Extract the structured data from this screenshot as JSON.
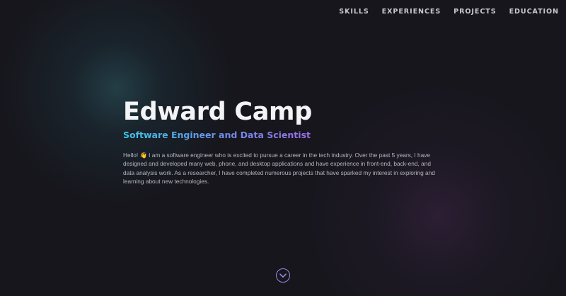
{
  "nav": {
    "items": [
      {
        "label": "SKILLS"
      },
      {
        "label": "EXPERIENCES"
      },
      {
        "label": "PROJECTS"
      },
      {
        "label": "EDUCATION"
      }
    ]
  },
  "hero": {
    "name": "Edward Camp",
    "subtitle": "Software Engineer and Data Scientist",
    "intro": "Hello! 👋 I am a software engineer who is excited to pursue a career in the tech industry. Over the past 5 years, I have designed and developed many web, phone, and desktop applications and have experience in front-end, back-end, and data analysis work. As a researcher, I have completed numerous projects that have sparked my interest in exploring and learning about new technologies."
  },
  "scroll_button": {
    "icon": "chevron-down-icon"
  },
  "colors": {
    "background": "#17161d",
    "accent_start": "#3ec7e8",
    "accent_end": "#9b6ee6",
    "nav_text": "#c8c8d0"
  }
}
